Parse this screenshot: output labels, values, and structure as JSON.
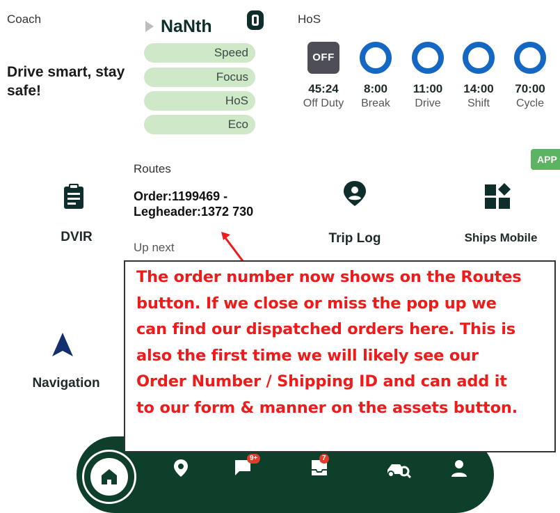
{
  "coach": {
    "label": "Coach",
    "message": "Drive smart, stay safe!"
  },
  "score": {
    "title": "NaNth",
    "categories": [
      "Speed",
      "Focus",
      "HoS",
      "Eco"
    ]
  },
  "hos": {
    "label": "HoS",
    "status_badge": "OFF",
    "items": [
      {
        "time": "45:24",
        "caption": "Off Duty"
      },
      {
        "time": "8:00",
        "caption": "Break"
      },
      {
        "time": "11:00",
        "caption": "Drive"
      },
      {
        "time": "14:00",
        "caption": "Shift"
      },
      {
        "time": "70:00",
        "caption": "Cycle"
      }
    ]
  },
  "app_tag": "APP",
  "tiles": {
    "dvir": "DVIR",
    "routes": {
      "label": "Routes",
      "order": "Order:1199469 - Legheader:1372 730",
      "status": "Up next"
    },
    "trip_log": "Trip Log",
    "ships_mobile": "Ships Mobile",
    "navigation": "Navigation"
  },
  "annotation": {
    "lines": [
      "The order number now shows on the Routes",
      "button. If we close or miss the pop up we",
      "can find our dispatched orders here. This is",
      "also the first time we will likely see our",
      "Order Number / Shipping ID and can add it",
      "to our form & manner on the assets button."
    ]
  },
  "bottom_nav": {
    "messages_badge": "9+",
    "inbox_badge": "7"
  },
  "colors": {
    "brand_dark": "#0d3f2a",
    "hos_ring": "#1468c4",
    "pill_green": "#cfe9c8",
    "annotation_red": "#ee1b1b",
    "app_tag": "#5cb361"
  }
}
